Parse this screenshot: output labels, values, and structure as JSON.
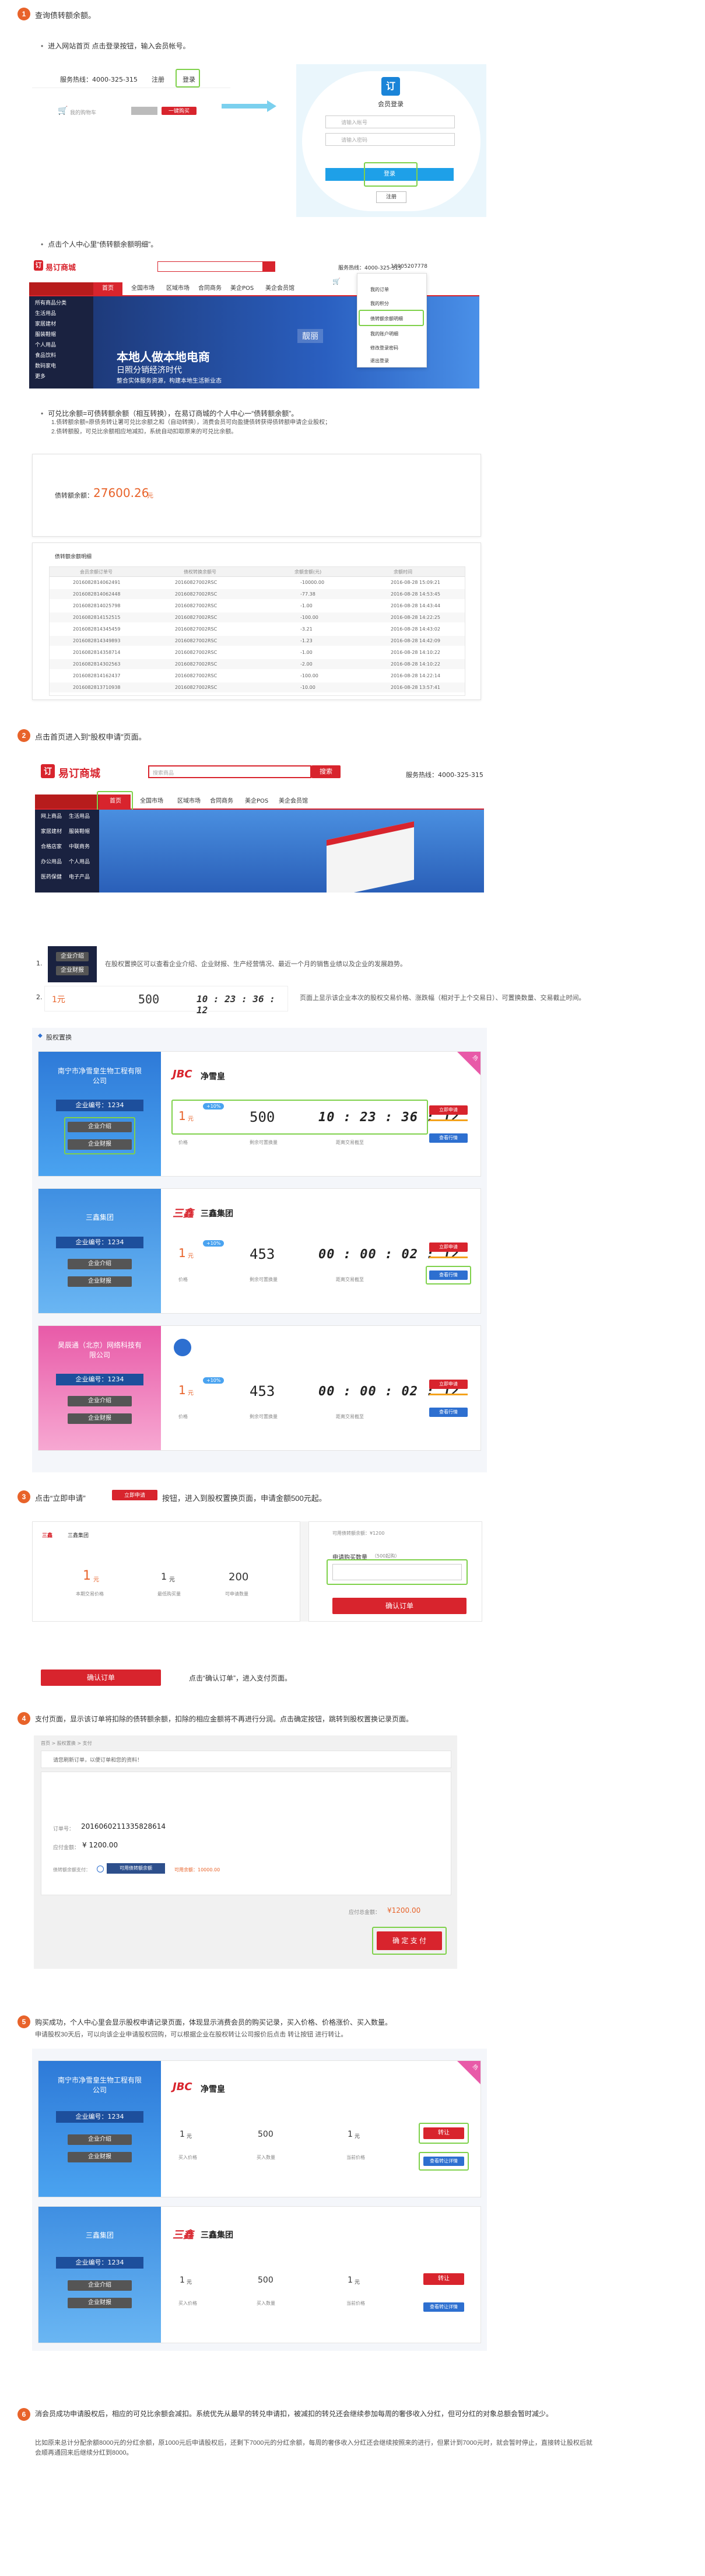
{
  "step1": {
    "num": "1",
    "title": "查询债转额余额。",
    "bullet1": "进入网站首页 点击登录按钮，输入会员帐号。",
    "bullet2": "点击个人中心里“债转额余额明细”。",
    "bullet3_title": "可兑比余额=可债转额余额（相互转换），在易订商城的个人中心一“债转额余额”。",
    "bullet3_line1": "1.债转额余额=原债务转让署可兑比余额之和（自动转换），消费会员可向盈捷债转获得债转额申请企业股权；",
    "bullet3_line2": "2.债转额股，可兑比余额相应地减扣，系统自动扣取原来的可兑比余额。",
    "topbar": {
      "hotline": "服务热线：4000-325-315",
      "register": "注册",
      "login": "登录",
      "cart": "我的购物车",
      "checkout": "一键购买"
    },
    "login_panel": {
      "title": "会员登录",
      "user_placeholder": "请输入帐号",
      "pwd_placeholder": "请输入密码",
      "login_btn": "登录",
      "register_btn": "注册"
    },
    "mall_header": {
      "logo": "易订商城",
      "hotline": "服务热线：4000-325-315",
      "nav": [
        "首页",
        "全国市场",
        "区域市场",
        "合同商务",
        "美企POS",
        "美企会员馆"
      ],
      "side": [
        "所有商品分类",
        "生活用品",
        "家居建材",
        "服装鞋帽",
        "个人用品",
        "食品饮料",
        "数码家电",
        "更多"
      ],
      "banner_title": "本地人做本地电商",
      "banner_sub": "日照分销经济时代",
      "banner_tag": "靓丽",
      "banner_tagline": "整合实体服务资源，构建本地生活新业态",
      "menu": [
        "我的订单",
        "我的积分",
        "债转额余额明细",
        "我的账户明细",
        "修改登录密码",
        "退出登录"
      ],
      "user": "18005207778"
    },
    "balance": {
      "label": "债转额余额：",
      "value": "27600.26",
      "unit": "元"
    },
    "ledger": {
      "title": "债转额余额明细",
      "headers": [
        "会员余额订单号",
        "债权转换余额号",
        "余额金额(元)",
        "余额时间"
      ],
      "rows": [
        [
          "2016082814062491",
          "20160827002RSC",
          "-10000.00",
          "2016-08-28 15:09:21"
        ],
        [
          "2016082814062448",
          "20160827002RSC",
          "-77.38",
          "2016-08-28 14:53:45"
        ],
        [
          "2016082814025798",
          "20160827002RSC",
          "-1.00",
          "2016-08-28 14:43:44"
        ],
        [
          "2016082814152515",
          "20160827002RSC",
          "-100.00",
          "2016-08-28 14:22:25"
        ],
        [
          "2016082814345459",
          "20160827002RSC",
          "-3.21",
          "2016-08-28 14:43:02"
        ],
        [
          "2016082814349893",
          "20160827002RSC",
          "-1.23",
          "2016-08-28 14:42:09"
        ],
        [
          "2016082814358714",
          "20160827002RSC",
          "-1.00",
          "2016-08-28 14:10:22"
        ],
        [
          "2016082814302563",
          "20160827002RSC",
          "-2.00",
          "2016-08-28 14:10:22"
        ],
        [
          "2016082814162437",
          "20160827002RSC",
          "-100.00",
          "2016-08-28 14:22:14"
        ],
        [
          "2016082813710938",
          "20160827002RSC",
          "-10.00",
          "2016-08-28 13:57:41"
        ]
      ]
    }
  },
  "step2": {
    "num": "2",
    "title": "点击首页进入到“股权申请”页面。",
    "header": {
      "logo": "易订商城",
      "search_placeholder": "搜索商品",
      "search_btn": "搜索",
      "hotline": "服务热线：4000-325-315",
      "nav": [
        "首页",
        "全国市场",
        "区域市场",
        "合同商务",
        "美企POS",
        "美企会员馆"
      ],
      "side": [
        "网上商品",
        "生活用品",
        "家居建材",
        "服装鞋帽",
        "合格店家",
        "中联商务",
        "办公用品",
        "个人用品",
        "医药保健",
        "电子产品"
      ]
    },
    "desc1_num": "1.",
    "desc1": "在股权置换区可以查看企业介绍、企业财报、生产经营情况、最近一个月的销售业绩以及企业的发展趋势。",
    "desc2_num": "2.",
    "desc2": "页面上显示该企业本次的股权交易价格、涨跌幅（相对于上个交易日）、可置换数量、交易截止时间。",
    "mini_btn1": "企业介绍",
    "mini_btn2": "企业财报",
    "mini_price": "1元",
    "mini_count": "500",
    "mini_timer": "10 : 23 : 36 : 12",
    "section_title": "股权置换",
    "cards": [
      {
        "company": "南宁市净雪皇生物工程有限公司",
        "id_label": "企业编号：1234",
        "btn1": "企业介绍",
        "btn2": "企业财报",
        "brand": "净雪皇",
        "brand_mark": "JBC",
        "price": "1",
        "price_unit": "元",
        "badge": "+10%",
        "count": "500",
        "timer": "10 : 23 : 36 : 12",
        "lbl_price": "价格",
        "lbl_count": "剩余可置换量",
        "lbl_timer": "距离交易截至",
        "apply": "立即申请",
        "detail": "查看行情",
        "ribbon": "热"
      },
      {
        "company": "三鑫集团",
        "id_label": "企业编号：1234",
        "btn1": "企业介绍",
        "btn2": "企业财报",
        "brand": "三鑫集团",
        "brand_mark": "三鑫",
        "price": "1",
        "price_unit": "元",
        "badge": "+10%",
        "count": "453",
        "timer": "00 : 00 : 02 : 12",
        "lbl_price": "价格",
        "lbl_count": "剩余可置换量",
        "lbl_timer": "距离交易截至",
        "apply": "立即申请",
        "detail": "查看行情"
      },
      {
        "company": "昊辰通（北京）网络科技有限公司",
        "id_label": "企业编号：1234",
        "btn1": "企业介绍",
        "btn2": "企业财报",
        "brand": "",
        "brand_mark": "",
        "price": "1",
        "price_unit": "元",
        "badge": "+10%",
        "count": "453",
        "timer": "00 : 00 : 02 : 12",
        "lbl_price": "价格",
        "lbl_count": "剩余可置换量",
        "lbl_timer": "距离交易截至",
        "apply": "立即申请",
        "detail": "查看行情"
      }
    ]
  },
  "step3": {
    "num": "3",
    "title_a": "点击“立即申请”",
    "title_btn": "立即申请",
    "title_b": "按钮，进入到股权置换页面，申请金额500元起。",
    "form": {
      "brand": "三鑫集团",
      "brand_mark": "三鑫",
      "price": "1",
      "price_unit": "元",
      "price_lbl": "本期交易价格",
      "min": "1",
      "min_unit": "元",
      "min_lbl": "最低购买量",
      "remain": "200",
      "remain_lbl": "可申请数量",
      "right_note": "可用债转额余额：¥1200",
      "qty_label": "申请购买数量",
      "qty_hint": "（500起购）",
      "confirm": "确认订单"
    },
    "confirm_btn": "确认订单",
    "confirm_note": "点击“确认订单”，进入支付页面。"
  },
  "step4": {
    "num": "4",
    "title": "支付页面，显示该订单将扣除的债转额余额，扣除的相应金额将不再进行分润。点击确定按钮，跳转到股权置换记录页面。",
    "crumb": "首页 > 股权置换 > 支付",
    "warn": "请您刷新订单，以便订单和您的资料！",
    "order_lbl": "订单号：",
    "order_no": "2016060211335828614",
    "amount_lbl": "应付金额：",
    "amount": "¥ 1200.00",
    "pay_lbl": "债转额余额支付：",
    "pay_method": "可用债转额余额",
    "pay_note": "可用余额：10000.00",
    "total_lbl": "应付总金额：",
    "total": "¥1200.00",
    "pay_btn": "确 定 支 付"
  },
  "step5": {
    "num": "5",
    "title": "购买成功，个人中心里会显示股权申请记录页面，体现显示消费会员的购买记录，买入价格、价格涨价、买入数量。",
    "line2": "申请股权30天后，可以向该企业申请股权回购，可以根据企业在股权转让公司报价后点击 转让按钮 进行转让。",
    "cards": [
      {
        "company": "南宁市净雪皇生物工程有限公司",
        "id_label": "企业编号：1234",
        "btn1": "企业介绍",
        "btn2": "企业财报",
        "brand": "净雪皇",
        "brand_mark": "JBC",
        "v1": "1",
        "v1_unit": "元",
        "v2": "500",
        "v3": "1",
        "v3_unit": "元",
        "l1": "买入价格",
        "l2": "买入数量",
        "l3": "当前价格",
        "action": "转让",
        "detail": "查看转让详情",
        "ribbon": "热"
      },
      {
        "company": "三鑫集团",
        "id_label": "企业编号：1234",
        "btn1": "企业介绍",
        "btn2": "企业财报",
        "brand": "三鑫集团",
        "brand_mark": "三鑫",
        "v1": "1",
        "v1_unit": "元",
        "v2": "500",
        "v3": "1",
        "v3_unit": "元",
        "l1": "买入价格",
        "l2": "买入数量",
        "l3": "当前价格",
        "action": "转让",
        "detail": "查看转让详情"
      }
    ]
  },
  "step6": {
    "num": "6",
    "title": "消会员成功申请股权后，相应的可兑比余额会减扣。系统优先从最早的转兑申请扣，被减扣的转兑还会继续参加每周的奢侈收入分红，但可分红的对象总额会暂时减少。",
    "line2": "比如原来总计分配余额8000元的分红余额，原1000元后申请股权后，还剩下7000元的分红余额，每周的奢侈收入分红还会继续按照来的进行，但累计到7000元时，就会暂时停止，直接转让股权后就会顺再通回来后继续分红到8000。"
  },
  "colors": {
    "accent": "#e8632a",
    "red": "#d8242d",
    "blue": "#2d6fd0",
    "green": "#7fd14b"
  }
}
